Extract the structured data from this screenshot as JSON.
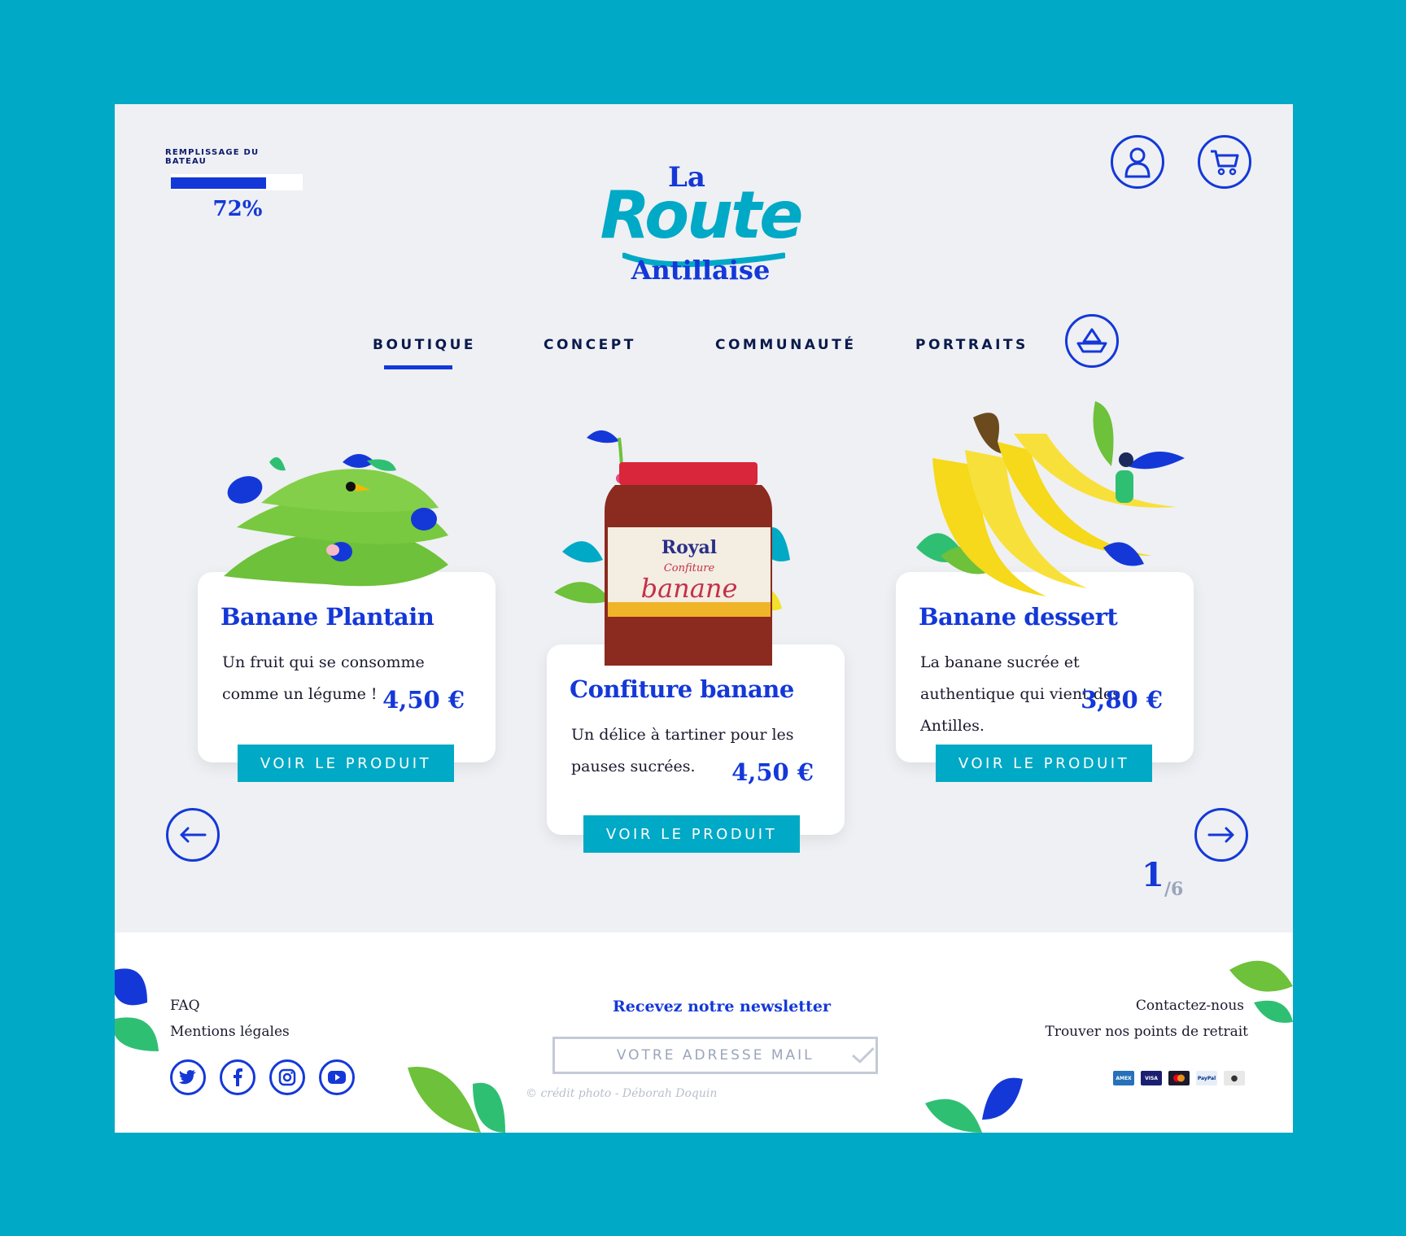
{
  "progress": {
    "label": "REMPLISSAGE DU BATEAU",
    "value_text": "72%",
    "fraction": 0.72
  },
  "logo": {
    "top": "La",
    "main": "Route",
    "bottom": "Antillaise"
  },
  "nav": [
    {
      "label": "BOUTIQUE",
      "active": true
    },
    {
      "label": "CONCEPT",
      "active": false
    },
    {
      "label": "COMMUNAUTÉ",
      "active": false
    },
    {
      "label": "PORTRAITS",
      "active": false
    }
  ],
  "products": [
    {
      "title": "Banane Plantain",
      "description": "Un fruit qui se consomme comme un légume !",
      "price": "4,50 €",
      "button": "VOIR LE PRODUIT"
    },
    {
      "title": "Confiture banane",
      "description": "Un délice à tartiner pour les pauses sucrées.",
      "price": "4,50 €",
      "button": "VOIR LE PRODUIT"
    },
    {
      "title": "Banane dessert",
      "description": "La banane sucrée et authentique qui vient des Antilles.",
      "price": "3,80 €",
      "button": "VOIR LE PRODUIT"
    }
  ],
  "jar": {
    "brand": "Royal",
    "line1": "Confiture",
    "line2": "banane"
  },
  "pager": {
    "current": "1",
    "total": "/6"
  },
  "footer": {
    "links_left": [
      "FAQ",
      "Mentions légales"
    ],
    "newsletter_title": "Recevez notre newsletter",
    "newsletter_placeholder": "VOTRE ADRESSE MAIL",
    "links_right": [
      "Contactez-nous",
      "Trouver nos points de retrait"
    ],
    "credit": "© crédit photo - Déborah Doquin",
    "socials": [
      "twitter-icon",
      "facebook-icon",
      "instagram-icon",
      "youtube-icon"
    ],
    "payments": [
      "AMEX",
      "VISA",
      "mastercard",
      "PayPal",
      "apple-pay"
    ]
  },
  "colors": {
    "accent": "#1438d8",
    "teal": "#00a9c6",
    "background": "#eef0f4"
  }
}
